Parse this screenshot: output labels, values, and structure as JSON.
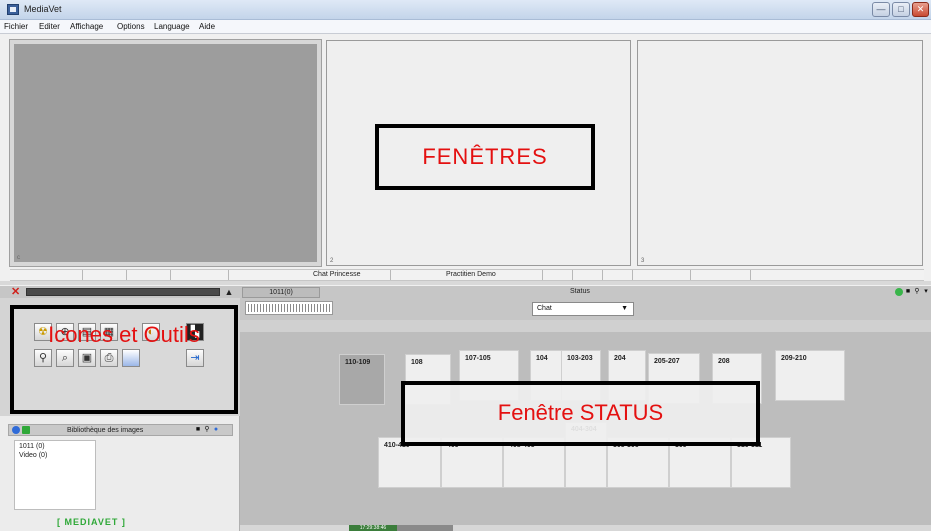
{
  "app": {
    "title": "MediaVet",
    "brand": "[ MEDIAVET ]",
    "window_buttons": {
      "minimize": "—",
      "maximize": "□",
      "close": "✕"
    }
  },
  "menu": [
    "Fichier",
    "Editer",
    "Affichage",
    "Options",
    "Language",
    "Aide"
  ],
  "viewer": {
    "annotation": "FENÊTRES",
    "info_strip": {
      "patient": "Chat Princesse",
      "practitioner": "Practitien Demo"
    },
    "pane_markers": [
      "c",
      "2",
      "3"
    ]
  },
  "toolbar": {
    "tab_label": "1011(0)",
    "status_title": "Status",
    "close_icon": "✕",
    "collapse_icon": "▲"
  },
  "tools": {
    "annotation": "Icones et Outils",
    "icons": [
      "radiation-icon",
      "zoom-icon",
      "document-icon",
      "film-icon",
      "colorwheel-icon",
      "grid-icon",
      "search-icon",
      "magnifier-icon",
      "scan-icon",
      "print-icon",
      "gradient-icon",
      "exit-icon"
    ]
  },
  "library": {
    "title": "Bibliothèque des images",
    "items": [
      "1011 (0)",
      "Video (0)"
    ]
  },
  "status": {
    "annotation": "Fenêtre STATUS",
    "filter_value": "Chat",
    "rooms_row1": [
      "110-109",
      "108",
      "107-105",
      "104",
      "103-203",
      "204",
      "205-207",
      "208",
      "209-210"
    ],
    "rooms_row2": [
      "410-410",
      "409",
      "408-405",
      "404-304",
      "305-306",
      "309",
      "310-311"
    ],
    "clock": "17:29:38:46"
  }
}
